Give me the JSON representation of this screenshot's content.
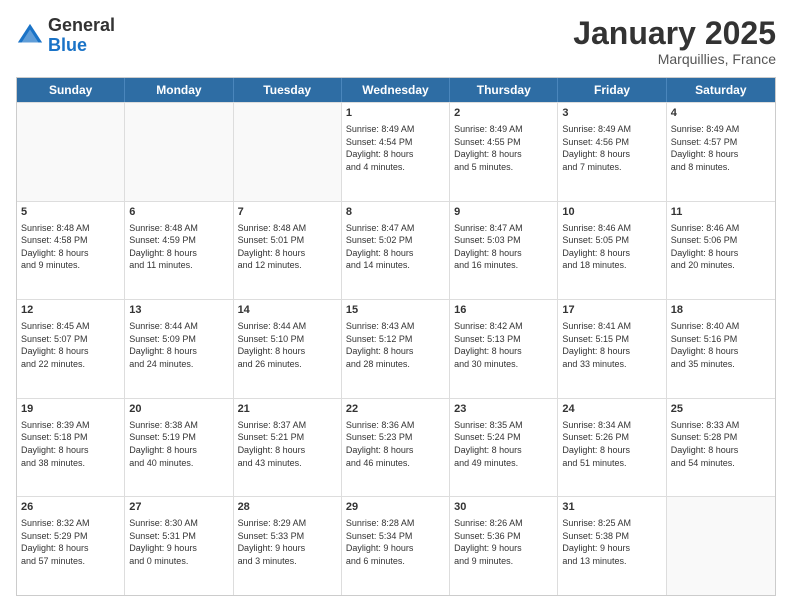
{
  "logo": {
    "general": "General",
    "blue": "Blue"
  },
  "header": {
    "title": "January 2025",
    "subtitle": "Marquillies, France"
  },
  "calendar": {
    "days": [
      "Sunday",
      "Monday",
      "Tuesday",
      "Wednesday",
      "Thursday",
      "Friday",
      "Saturday"
    ],
    "rows": [
      [
        {
          "day": "",
          "lines": []
        },
        {
          "day": "",
          "lines": []
        },
        {
          "day": "",
          "lines": []
        },
        {
          "day": "1",
          "lines": [
            "Sunrise: 8:49 AM",
            "Sunset: 4:54 PM",
            "Daylight: 8 hours",
            "and 4 minutes."
          ]
        },
        {
          "day": "2",
          "lines": [
            "Sunrise: 8:49 AM",
            "Sunset: 4:55 PM",
            "Daylight: 8 hours",
            "and 5 minutes."
          ]
        },
        {
          "day": "3",
          "lines": [
            "Sunrise: 8:49 AM",
            "Sunset: 4:56 PM",
            "Daylight: 8 hours",
            "and 7 minutes."
          ]
        },
        {
          "day": "4",
          "lines": [
            "Sunrise: 8:49 AM",
            "Sunset: 4:57 PM",
            "Daylight: 8 hours",
            "and 8 minutes."
          ]
        }
      ],
      [
        {
          "day": "5",
          "lines": [
            "Sunrise: 8:48 AM",
            "Sunset: 4:58 PM",
            "Daylight: 8 hours",
            "and 9 minutes."
          ]
        },
        {
          "day": "6",
          "lines": [
            "Sunrise: 8:48 AM",
            "Sunset: 4:59 PM",
            "Daylight: 8 hours",
            "and 11 minutes."
          ]
        },
        {
          "day": "7",
          "lines": [
            "Sunrise: 8:48 AM",
            "Sunset: 5:01 PM",
            "Daylight: 8 hours",
            "and 12 minutes."
          ]
        },
        {
          "day": "8",
          "lines": [
            "Sunrise: 8:47 AM",
            "Sunset: 5:02 PM",
            "Daylight: 8 hours",
            "and 14 minutes."
          ]
        },
        {
          "day": "9",
          "lines": [
            "Sunrise: 8:47 AM",
            "Sunset: 5:03 PM",
            "Daylight: 8 hours",
            "and 16 minutes."
          ]
        },
        {
          "day": "10",
          "lines": [
            "Sunrise: 8:46 AM",
            "Sunset: 5:05 PM",
            "Daylight: 8 hours",
            "and 18 minutes."
          ]
        },
        {
          "day": "11",
          "lines": [
            "Sunrise: 8:46 AM",
            "Sunset: 5:06 PM",
            "Daylight: 8 hours",
            "and 20 minutes."
          ]
        }
      ],
      [
        {
          "day": "12",
          "lines": [
            "Sunrise: 8:45 AM",
            "Sunset: 5:07 PM",
            "Daylight: 8 hours",
            "and 22 minutes."
          ]
        },
        {
          "day": "13",
          "lines": [
            "Sunrise: 8:44 AM",
            "Sunset: 5:09 PM",
            "Daylight: 8 hours",
            "and 24 minutes."
          ]
        },
        {
          "day": "14",
          "lines": [
            "Sunrise: 8:44 AM",
            "Sunset: 5:10 PM",
            "Daylight: 8 hours",
            "and 26 minutes."
          ]
        },
        {
          "day": "15",
          "lines": [
            "Sunrise: 8:43 AM",
            "Sunset: 5:12 PM",
            "Daylight: 8 hours",
            "and 28 minutes."
          ]
        },
        {
          "day": "16",
          "lines": [
            "Sunrise: 8:42 AM",
            "Sunset: 5:13 PM",
            "Daylight: 8 hours",
            "and 30 minutes."
          ]
        },
        {
          "day": "17",
          "lines": [
            "Sunrise: 8:41 AM",
            "Sunset: 5:15 PM",
            "Daylight: 8 hours",
            "and 33 minutes."
          ]
        },
        {
          "day": "18",
          "lines": [
            "Sunrise: 8:40 AM",
            "Sunset: 5:16 PM",
            "Daylight: 8 hours",
            "and 35 minutes."
          ]
        }
      ],
      [
        {
          "day": "19",
          "lines": [
            "Sunrise: 8:39 AM",
            "Sunset: 5:18 PM",
            "Daylight: 8 hours",
            "and 38 minutes."
          ]
        },
        {
          "day": "20",
          "lines": [
            "Sunrise: 8:38 AM",
            "Sunset: 5:19 PM",
            "Daylight: 8 hours",
            "and 40 minutes."
          ]
        },
        {
          "day": "21",
          "lines": [
            "Sunrise: 8:37 AM",
            "Sunset: 5:21 PM",
            "Daylight: 8 hours",
            "and 43 minutes."
          ]
        },
        {
          "day": "22",
          "lines": [
            "Sunrise: 8:36 AM",
            "Sunset: 5:23 PM",
            "Daylight: 8 hours",
            "and 46 minutes."
          ]
        },
        {
          "day": "23",
          "lines": [
            "Sunrise: 8:35 AM",
            "Sunset: 5:24 PM",
            "Daylight: 8 hours",
            "and 49 minutes."
          ]
        },
        {
          "day": "24",
          "lines": [
            "Sunrise: 8:34 AM",
            "Sunset: 5:26 PM",
            "Daylight: 8 hours",
            "and 51 minutes."
          ]
        },
        {
          "day": "25",
          "lines": [
            "Sunrise: 8:33 AM",
            "Sunset: 5:28 PM",
            "Daylight: 8 hours",
            "and 54 minutes."
          ]
        }
      ],
      [
        {
          "day": "26",
          "lines": [
            "Sunrise: 8:32 AM",
            "Sunset: 5:29 PM",
            "Daylight: 8 hours",
            "and 57 minutes."
          ]
        },
        {
          "day": "27",
          "lines": [
            "Sunrise: 8:30 AM",
            "Sunset: 5:31 PM",
            "Daylight: 9 hours",
            "and 0 minutes."
          ]
        },
        {
          "day": "28",
          "lines": [
            "Sunrise: 8:29 AM",
            "Sunset: 5:33 PM",
            "Daylight: 9 hours",
            "and 3 minutes."
          ]
        },
        {
          "day": "29",
          "lines": [
            "Sunrise: 8:28 AM",
            "Sunset: 5:34 PM",
            "Daylight: 9 hours",
            "and 6 minutes."
          ]
        },
        {
          "day": "30",
          "lines": [
            "Sunrise: 8:26 AM",
            "Sunset: 5:36 PM",
            "Daylight: 9 hours",
            "and 9 minutes."
          ]
        },
        {
          "day": "31",
          "lines": [
            "Sunrise: 8:25 AM",
            "Sunset: 5:38 PM",
            "Daylight: 9 hours",
            "and 13 minutes."
          ]
        },
        {
          "day": "",
          "lines": []
        }
      ]
    ]
  }
}
